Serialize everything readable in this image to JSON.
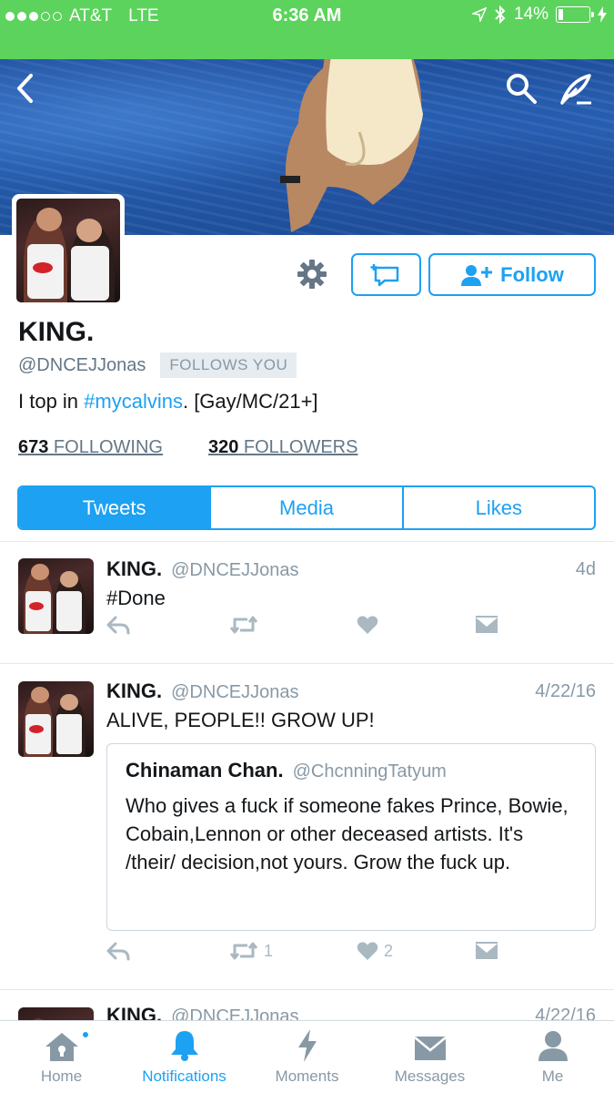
{
  "status_bar": {
    "carrier": "AT&T",
    "network": "LTE",
    "time": "6:36 AM",
    "battery": "14%"
  },
  "profile": {
    "name": "KING.",
    "handle": "@DNCEJJonas",
    "follows_you": "FOLLOWS YOU",
    "bio_prefix": "I top in ",
    "bio_hashtag": "#mycalvins",
    "bio_suffix": ". [Gay/MC/21+]",
    "following_count": "673",
    "following_label": " FOLLOWING",
    "followers_count": "320",
    "followers_label": " FOLLOWERS",
    "follow_button": "Follow"
  },
  "tabs": [
    {
      "label": "Tweets",
      "active": true
    },
    {
      "label": "Media",
      "active": false
    },
    {
      "label": "Likes",
      "active": false
    }
  ],
  "tweets": [
    {
      "name": "KING.",
      "handle": "@DNCEJJonas",
      "time": "4d",
      "text": "#Done"
    },
    {
      "name": "KING.",
      "handle": "@DNCEJJonas",
      "time": "4/22/16",
      "text": "ALIVE, PEOPLE!! GROW UP!",
      "quote": {
        "name": "Chinaman Chan.",
        "handle": "@ChcnningTatyum",
        "text": "Who gives a fuck if someone fakes Prince, Bowie, Cobain,Lennon or other deceased artists. It's /their/ decision,not yours. Grow the fuck up."
      },
      "retweets": "1",
      "likes": "2"
    },
    {
      "name": "KING.",
      "handle": "@DNCEJJonas",
      "time": "4/22/16"
    }
  ],
  "tab_bar": [
    {
      "label": "Home",
      "icon": "home-icon"
    },
    {
      "label": "Notifications",
      "icon": "bell-icon"
    },
    {
      "label": "Moments",
      "icon": "lightning-icon"
    },
    {
      "label": "Messages",
      "icon": "envelope-icon"
    },
    {
      "label": "Me",
      "icon": "person-icon"
    }
  ],
  "colors": {
    "accent": "#1da1f2",
    "status_bar": "#5cd35c"
  }
}
